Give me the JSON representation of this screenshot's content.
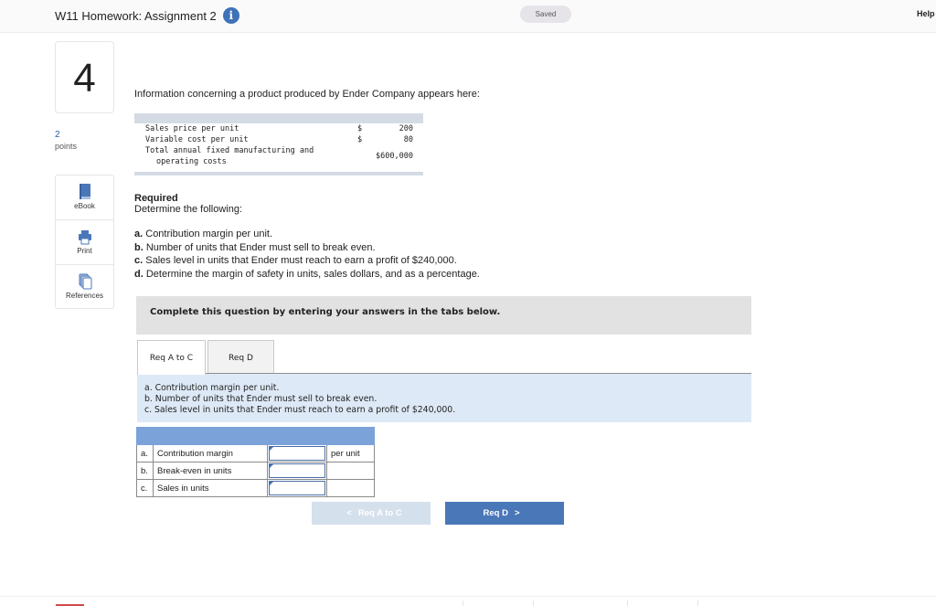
{
  "header": {
    "title": "W11 Homework: Assignment 2",
    "info_icon": "i",
    "saved_status": "Saved",
    "help_label": "Help"
  },
  "question": {
    "number": "4",
    "points_value": "2",
    "points_label": "points"
  },
  "side_tools": [
    {
      "label": "eBook",
      "icon": "book-icon"
    },
    {
      "label": "Print",
      "icon": "printer-icon"
    },
    {
      "label": "References",
      "icon": "references-icon"
    }
  ],
  "problem": {
    "intro": "Information concerning a product produced by Ender Company appears here:",
    "data_rows": [
      {
        "label": "Sales price per unit",
        "currency": "$",
        "value": "200"
      },
      {
        "label": "Variable cost per unit",
        "currency": "$",
        "value": "80"
      },
      {
        "label_line1": "Total annual fixed manufacturing and",
        "label_line2": "operating costs",
        "value": "$600,000"
      }
    ],
    "required_title": "Required",
    "required_subtitle": "Determine the following:",
    "requirements": [
      {
        "letter": "a.",
        "text": " Contribution margin per unit."
      },
      {
        "letter": "b.",
        "text": " Number of units that Ender must sell to break even."
      },
      {
        "letter": "c.",
        "text": " Sales level in units that Ender must reach to earn a profit of $240,000."
      },
      {
        "letter": "d.",
        "text": " Determine the margin of safety in units, sales dollars, and as a percentage."
      }
    ]
  },
  "instructions_banner": "Complete this question by entering your answers in the tabs below.",
  "tabs": [
    {
      "label": "Req A to C",
      "active": true
    },
    {
      "label": "Req D",
      "active": false
    }
  ],
  "tab_panel": {
    "lines": [
      "a. Contribution margin per unit.",
      "b. Number of units that Ender must sell to break even.",
      "c. Sales level in units that Ender must reach to earn a profit of $240,000."
    ]
  },
  "answer_table": {
    "rows": [
      {
        "letter": "a.",
        "label": "Contribution margin",
        "value": "",
        "unit": "per unit"
      },
      {
        "letter": "b.",
        "label": "Break-even in units",
        "value": "",
        "unit": ""
      },
      {
        "letter": "c.",
        "label": "Sales in units",
        "value": "",
        "unit": ""
      }
    ]
  },
  "navigation": {
    "prev_label": "Req A to C",
    "prev_chevron": "<",
    "next_label": "Req D",
    "next_chevron": ">"
  }
}
